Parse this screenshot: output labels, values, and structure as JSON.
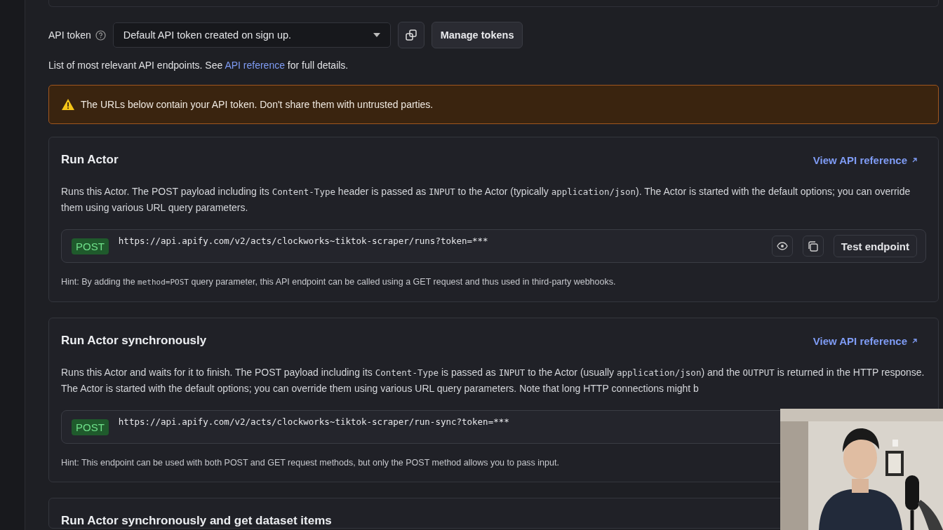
{
  "token": {
    "label": "API token",
    "value": "Default API token created on sign up."
  },
  "manage_button": "Manage tokens",
  "intro": {
    "before": "List of most relevant API endpoints. See ",
    "link": "API reference",
    "after": " for full details."
  },
  "warning": "The URLs below contain your API token. Don't share them with untrusted parties.",
  "endpoints": [
    {
      "title": "Run Actor",
      "link": "View API reference",
      "description": [
        {
          "kind": "text",
          "text": "Runs this Actor. The POST payload including its "
        },
        {
          "kind": "code",
          "text": "Content-Type"
        },
        {
          "kind": "text",
          "text": " header is passed as "
        },
        {
          "kind": "code",
          "text": "INPUT"
        },
        {
          "kind": "text",
          "text": " to the Actor (typically "
        },
        {
          "kind": "code",
          "text": "application/json"
        },
        {
          "kind": "text",
          "text": "). The Actor is started with the default options; you can override them using various URL query parameters."
        }
      ],
      "method": "POST",
      "url": "https://api.apify.com/v2/acts/clockworks~tiktok-scraper/runs?token=***",
      "test_button": "Test endpoint",
      "hint": [
        {
          "kind": "text",
          "text": "Hint: By adding the "
        },
        {
          "kind": "code",
          "text": "method=POST"
        },
        {
          "kind": "text",
          "text": " query parameter, this API endpoint can be called using a GET request and thus used in third-party webhooks."
        }
      ]
    },
    {
      "title": "Run Actor synchronously",
      "link": "View API reference",
      "description": [
        {
          "kind": "text",
          "text": "Runs this Actor and waits for it to finish. The POST payload including its "
        },
        {
          "kind": "code",
          "text": "Content-Type"
        },
        {
          "kind": "text",
          "text": " is passed as "
        },
        {
          "kind": "code",
          "text": "INPUT"
        },
        {
          "kind": "text",
          "text": " to the Actor (usually "
        },
        {
          "kind": "code",
          "text": "application/json"
        },
        {
          "kind": "text",
          "text": ") and the "
        },
        {
          "kind": "code",
          "text": "OUTPUT"
        },
        {
          "kind": "text",
          "text": " is returned in the HTTP response. The Actor is started with the default options; you can override them using various URL query parameters. Note that long HTTP connections might b"
        }
      ],
      "method": "POST",
      "url": "https://api.apify.com/v2/acts/clockworks~tiktok-scraper/run-sync?token=***",
      "hint": [
        {
          "kind": "text",
          "text": "Hint: This endpoint can be used with both POST and GET request methods, but only the POST method allows you to pass input."
        }
      ]
    },
    {
      "title": "Run Actor synchronously and get dataset items"
    }
  ]
}
